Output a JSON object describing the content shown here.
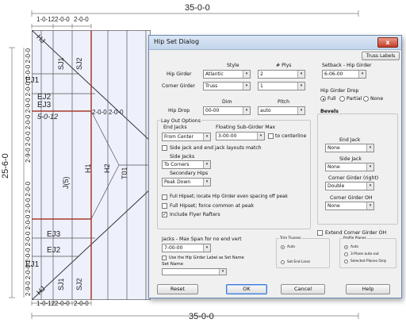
{
  "top_dims": {
    "overall": "35-0-0",
    "segments": [
      "1-0-12",
      "2-0-0",
      "2-0-0"
    ]
  },
  "bottom_dims": {
    "overall": "35-0-0",
    "segments": [
      "1-0-12",
      "2-0-0",
      "2-0-0"
    ]
  },
  "left_dims": {
    "overall": "25-6-0",
    "top_stack": "2-9-0 2-0-0 2-0-0 2-0-0 2-0-0 2-0-0 2-0-0",
    "bottom_stack": "2-9-0 2-0-0 2-0-0 2-0-0 2-0-0 2-0-0 2-0-0"
  },
  "plan": {
    "hj_top": "HJ",
    "hj_bottom": "HJ",
    "sj1_top": "SJ1",
    "sj2_top": "SJ2",
    "sj1_bottom": "SJ1",
    "sj2_bottom": "SJ2",
    "ej1_top": "EJ1",
    "ej2_top": "EJ2",
    "ej3_top": "EJ3",
    "ej3_bottom": "EJ3",
    "ej2_bottom": "EJ2",
    "ej1_bottom": "EJ1",
    "setback": "5-0-12",
    "mid_dims": "2-0-0 2-0-0",
    "j5": "J(5)",
    "h1": "H1",
    "h2": "H2",
    "t01": "T01"
  },
  "dialog": {
    "title": "Hip Set Dialog",
    "close": "x",
    "truss_labels": "Truss Labels",
    "col_style": "Style",
    "col_plys": "# Plys",
    "hip_girder_label": "Hip Girder",
    "hip_girder_style": "Atlantic",
    "hip_girder_plys": "2",
    "corner_girder_label": "Corner Girder",
    "corner_girder_style": "Truss",
    "corner_girder_plys": "1",
    "setback_label": "Setback - Hip Girder",
    "setback_value": "6-06-00",
    "hip_girder_drop_label": "Hip Girder Drop",
    "drop_full": "Full",
    "drop_partial": "Partial",
    "drop_none": "None",
    "dim_label": "Dim",
    "pitch_label": "Pitch",
    "hip_drop_label": "Hip Drop",
    "hip_drop_dim": "00-00",
    "hip_drop_pitch": "auto",
    "layout_options": "Lay Out Options",
    "end_jacks_label": "End Jacks",
    "end_jacks_value": "From Center",
    "floating_label": "Floating Sub-Girder Max",
    "floating_value": "3-00-00",
    "to_centerline": "to centerline",
    "side_end_match": "Side jack and end jack layouts match",
    "side_jacks_label": "Side Jacks",
    "side_jacks_value": "To Corners",
    "secondary_hips_label": "Secondary Hips",
    "secondary_hips_value": "Peak Down",
    "full_hipset_locate": "Full Hipset; locate Hip Girder even spacing off peak",
    "full_hipset_force": "Full Hipset; force common at peak",
    "include_flyer": "Include Flyer Rafters",
    "bevels_label": "Bevels",
    "bev_end_jack_label": "End Jack",
    "bev_end_jack_value": "None",
    "bev_side_jack_label": "Side Jack",
    "bev_side_jack_value": "None",
    "bev_corner_right_label": "Corner Girder (right)",
    "bev_corner_right_value": "Double",
    "bev_corner_oh_label": "Corner Girder OH",
    "bev_corner_oh_value": "None",
    "extend_corner_oh": "Extend Corner Girder OH",
    "jacks_max_span_label": "Jacks - Max Span for no end vert",
    "jacks_max_span_value": "7-00-00",
    "use_hip_label": "Use the Hip Girder Label as Set Name",
    "set_name_label": "Set Name",
    "set_name_value": "",
    "trim_trusses_label": "Trim Trusses",
    "trim_auto": "Auto",
    "trim_set_end": "Set End Lines",
    "profile_planes_label": "Profile Planes",
    "pp_auto": "Auto",
    "pp_3plane": "3-Plane auto-out",
    "pp_selected": "Selected Planes Only",
    "reset": "Reset",
    "ok": "OK",
    "cancel": "Cancel",
    "help": "Help"
  }
}
